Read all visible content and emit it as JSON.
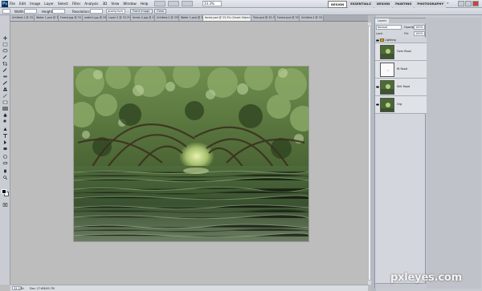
{
  "menubar": {
    "logo": "Ps",
    "items": [
      "File",
      "Edit",
      "Image",
      "Layer",
      "Select",
      "Filter",
      "Analysis",
      "3D",
      "View",
      "Window",
      "Help"
    ],
    "zoom": "33.3%",
    "workspaces": [
      "DESIGN",
      "ESSENTIALS",
      "DESIGN",
      "PAINTING",
      "PHOTOGRAPHY"
    ],
    "active_workspace": "ESSENTIALS",
    "cs_live": "»"
  },
  "options": {
    "style_label": "Style:",
    "width_label": "Width:",
    "height_label": "Height:",
    "resolution_label": "Resolution:",
    "resolution_unit": "pixels/inch",
    "front_image": "Front Image",
    "clear": "Clear"
  },
  "tabs": [
    "Untitled-1 @ 33.3%...",
    "Water 1.psd @ 33.3%",
    "Forest.jpg @ 33.3%",
    "water2.jpg @ 33.3%",
    "Layer 2 @ 33.3%",
    "forest-2.jpg @ 33%",
    "Untitled-2 @ 33%",
    "Water 1.psd @ 33.3% (Layer 1, RGB/8)",
    "Tree.psd @ 33.3%",
    "Forest.psd @ 33%",
    "Untitled-3 @ 33.3%",
    "forest-3.jpg @ 33.3%"
  ],
  "active_tab": "forest.psd @ 33.3% (Smart Object 1 copy, RGB/8)",
  "status": {
    "zoom": "33.33%",
    "doc": "Doc: 17.6M/45.7M"
  },
  "layers_panel": {
    "tab": "Layers",
    "blend_mode": "Normal",
    "opacity_label": "Opacity:",
    "opacity": "100%",
    "lock_label": "Lock:",
    "fill_label": "Fill:",
    "fill": "100%",
    "group_name": "Lighting",
    "layers": [
      {
        "name": "Over flood",
        "thumb": "forest"
      },
      {
        "name": "flt flood",
        "thumb": "white"
      },
      {
        "name": "Shit flood",
        "thumb": "forest"
      },
      {
        "name": "Org",
        "thumb": "forest"
      }
    ]
  },
  "watermark": "pxleyes.com"
}
